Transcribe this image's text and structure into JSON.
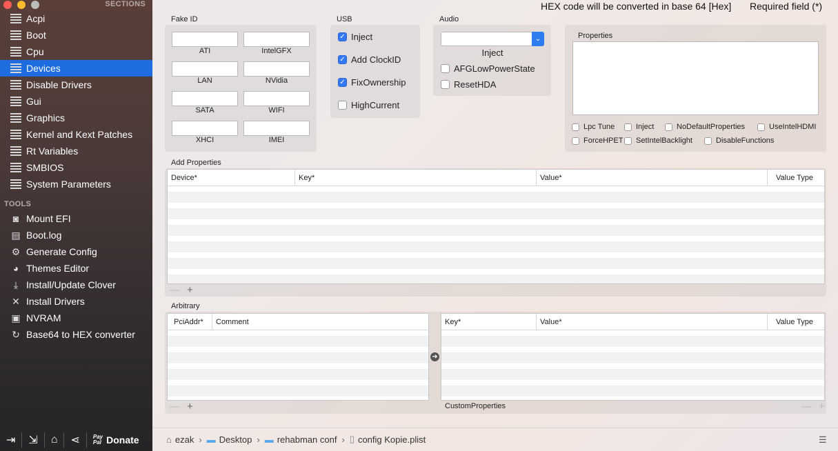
{
  "sidebar": {
    "sections_title": "SECTIONS",
    "tools_title": "TOOLS",
    "items": [
      {
        "label": "Acpi",
        "icon": "list-icon"
      },
      {
        "label": "Boot",
        "icon": "list-icon"
      },
      {
        "label": "Cpu",
        "icon": "list-icon"
      },
      {
        "label": "Devices",
        "icon": "list-icon",
        "active": true
      },
      {
        "label": "Disable Drivers",
        "icon": "list-icon"
      },
      {
        "label": "Gui",
        "icon": "list-icon"
      },
      {
        "label": "Graphics",
        "icon": "list-icon"
      },
      {
        "label": "Kernel and Kext Patches",
        "icon": "list-icon"
      },
      {
        "label": "Rt Variables",
        "icon": "list-icon"
      },
      {
        "label": "SMBIOS",
        "icon": "list-icon"
      },
      {
        "label": "System Parameters",
        "icon": "list-icon"
      }
    ],
    "tools": [
      {
        "label": "Mount EFI",
        "icon": "disk-icon"
      },
      {
        "label": "Boot.log",
        "icon": "log-icon"
      },
      {
        "label": "Generate Config",
        "icon": "gears-icon"
      },
      {
        "label": "Themes Editor",
        "icon": "palette-icon"
      },
      {
        "label": "Install/Update Clover",
        "icon": "download-icon"
      },
      {
        "label": "Install Drivers",
        "icon": "tools-icon"
      },
      {
        "label": "NVRAM",
        "icon": "chip-icon"
      },
      {
        "label": "Base64 to HEX converter",
        "icon": "refresh-icon"
      }
    ],
    "bottom": {
      "donate_label": "Donate",
      "paypal_line1": "Pay",
      "paypal_line2": "Pal"
    }
  },
  "header": {
    "hex_note": "HEX code will be converted in base 64 [Hex]",
    "required_note": "Required field (*)"
  },
  "fake_id": {
    "title": "Fake ID",
    "fields": [
      {
        "label": "ATI",
        "value": ""
      },
      {
        "label": "IntelGFX",
        "value": ""
      },
      {
        "label": "LAN",
        "value": ""
      },
      {
        "label": "NVidia",
        "value": ""
      },
      {
        "label": "SATA",
        "value": ""
      },
      {
        "label": "WIFI",
        "value": ""
      },
      {
        "label": "XHCI",
        "value": ""
      },
      {
        "label": "IMEI",
        "value": ""
      }
    ]
  },
  "usb": {
    "title": "USB",
    "options": [
      {
        "label": "Inject",
        "checked": true
      },
      {
        "label": "Add ClockID",
        "checked": true
      },
      {
        "label": "FixOwnership",
        "checked": true
      },
      {
        "label": "HighCurrent",
        "checked": false
      }
    ]
  },
  "audio": {
    "title": "Audio",
    "inject_value": "",
    "inject_label": "Inject",
    "options": [
      {
        "label": "AFGLowPowerState",
        "checked": false
      },
      {
        "label": "ResetHDA",
        "checked": false
      }
    ]
  },
  "properties": {
    "title": "Properties",
    "value": "",
    "options": [
      {
        "label": "Lpc Tune",
        "checked": false
      },
      {
        "label": "Inject",
        "checked": false
      },
      {
        "label": "NoDefaultProperties",
        "checked": false
      },
      {
        "label": "UseIntelHDMI",
        "checked": false
      },
      {
        "label": "ForceHPET",
        "checked": false
      },
      {
        "label": "SetIntelBacklight",
        "checked": false
      },
      {
        "label": "DisableFunctions",
        "checked": false
      }
    ]
  },
  "add_properties": {
    "title": "Add Properties",
    "columns": [
      "Device*",
      "Key*",
      "Value*",
      "Value Type"
    ],
    "rows": []
  },
  "arbitrary": {
    "title": "Arbitrary",
    "left_columns": [
      "PciAddr*",
      "Comment"
    ],
    "right_columns": [
      "Key*",
      "Value*",
      "Value Type"
    ],
    "custom_properties_label": "CustomProperties"
  },
  "controls": {
    "minus": "—",
    "plus": "+"
  },
  "breadcrumb": {
    "items": [
      "ezak",
      "Desktop",
      "rehabman conf",
      "config Kopie.plist"
    ]
  },
  "colors": {
    "accent": "#1d6de0",
    "checkbox_on": "#3478f6"
  }
}
